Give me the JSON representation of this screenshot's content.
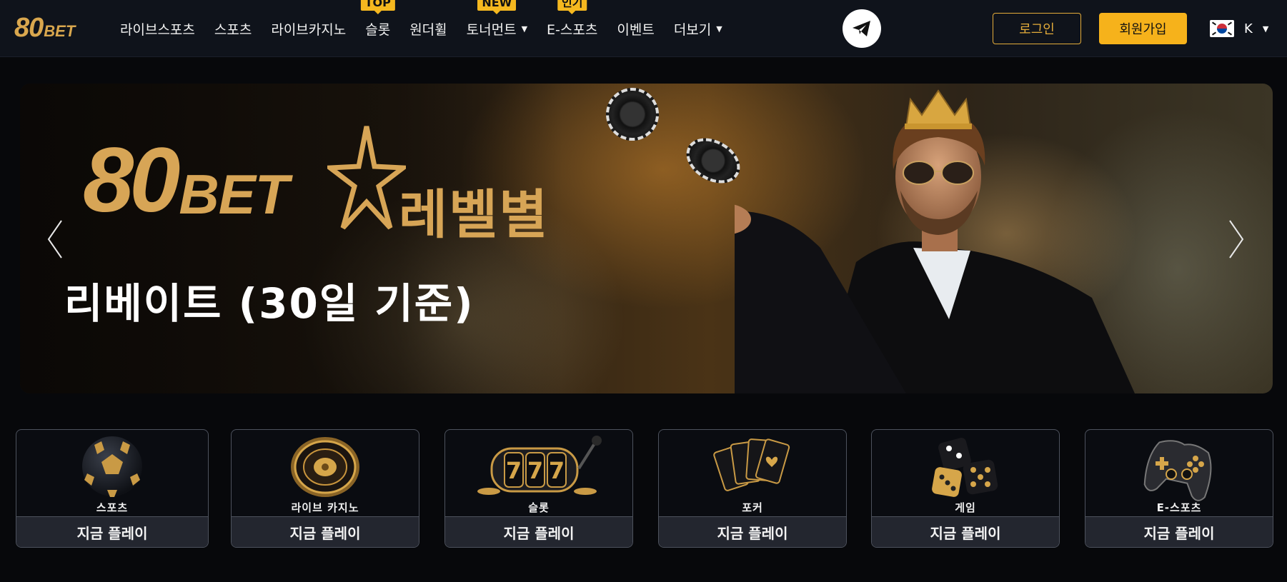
{
  "header": {
    "logo_num": "80",
    "logo_word": "BET",
    "nav": [
      {
        "label": "라이브스포츠",
        "badge": "",
        "caret": false
      },
      {
        "label": "스포츠",
        "badge": "",
        "caret": false
      },
      {
        "label": "라이브카지노",
        "badge": "",
        "caret": false
      },
      {
        "label": "슬롯",
        "badge": "TOP",
        "caret": false
      },
      {
        "label": "원더휠",
        "badge": "",
        "caret": false
      },
      {
        "label": "토너먼트",
        "badge": "NEW",
        "caret": true
      },
      {
        "label": "E-스포츠",
        "badge": "인기",
        "caret": false
      },
      {
        "label": "이벤트",
        "badge": "",
        "caret": false
      },
      {
        "label": "더보기",
        "badge": "",
        "caret": true
      }
    ],
    "telegram_icon": "telegram-icon",
    "login_label": "로그인",
    "signup_label": "회원가입",
    "language_code": "K"
  },
  "hero": {
    "logo_num": "80",
    "logo_word": "BET",
    "title": "레벨별",
    "subtitle": "리베이트 (30일 기준)"
  },
  "categories": [
    {
      "label": "스포츠",
      "play_label": "지금 플레이",
      "icon": "soccer-ball-icon"
    },
    {
      "label": "라이브 카지노",
      "play_label": "지금 플레이",
      "icon": "roulette-icon"
    },
    {
      "label": "슬롯",
      "play_label": "지금 플레이",
      "icon": "slot-machine-icon"
    },
    {
      "label": "포커",
      "play_label": "지금 플레이",
      "icon": "playing-cards-icon"
    },
    {
      "label": "게임",
      "play_label": "지금 플레이",
      "icon": "dice-icon"
    },
    {
      "label": "E-스포츠",
      "play_label": "지금 플레이",
      "icon": "gamepad-icon"
    }
  ],
  "colors": {
    "accent_gold": "#f6b21b",
    "logo_gold": "#d9a74e",
    "header_bg": "#0f131b",
    "page_bg": "#07080b"
  }
}
